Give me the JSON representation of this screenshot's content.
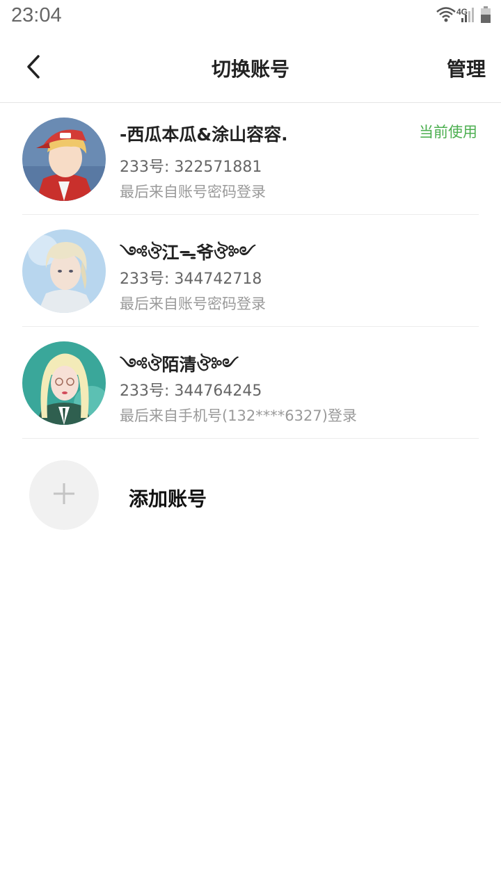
{
  "status_bar": {
    "time": "23:04",
    "network": "4G",
    "icons": [
      "wifi-icon",
      "signal-icon",
      "battery-icon"
    ]
  },
  "header": {
    "title": "切换账号",
    "manage_label": "管理",
    "back_icon": "chevron-left-icon"
  },
  "accounts": [
    {
      "name": "-西瓜本瓜&涂山容容.",
      "id_text": "233号: 322571881",
      "login_text": "最后来自账号密码登录",
      "badge": "当前使用"
    },
    {
      "name": "༺ঔ江ᯓ爷ঔ༻",
      "id_text": "233号: 344742718",
      "login_text": "最后来自账号密码登录"
    },
    {
      "name": "༺ঔ陌清ঔ༻",
      "id_text": "233号: 344764245",
      "login_text": "最后来自手机号(132****6327)登录"
    }
  ],
  "add_account": {
    "label": "添加账号",
    "icon": "plus-icon"
  },
  "colors": {
    "accent_green": "#4caf50",
    "divider": "#ececec"
  }
}
